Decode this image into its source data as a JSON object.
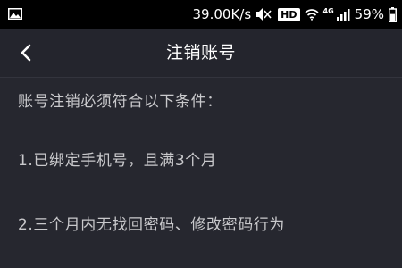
{
  "status_bar": {
    "left_icon": "gallery-icon",
    "network_speed": "39.00K/s",
    "icons": [
      "mute-vibrate-icon",
      "hd-badge",
      "wifi-icon",
      "4g-signal-icon",
      "battery-icon"
    ],
    "hd_label": "HD",
    "network_type": "4G",
    "battery_percent": "59%",
    "battery_level": 0.59
  },
  "header": {
    "back_icon": "chevron-left-icon",
    "title": "注销账号"
  },
  "content": {
    "intro": "账号注销必须符合以下条件：",
    "conditions": [
      "1.已绑定手机号，且满3个月",
      "2.三个月内无找回密码、修改密码行为"
    ]
  },
  "colors": {
    "background": "#24252d",
    "status_bar": "#000000",
    "title_text": "#ffffff",
    "body_text": "#c9c9cc"
  }
}
